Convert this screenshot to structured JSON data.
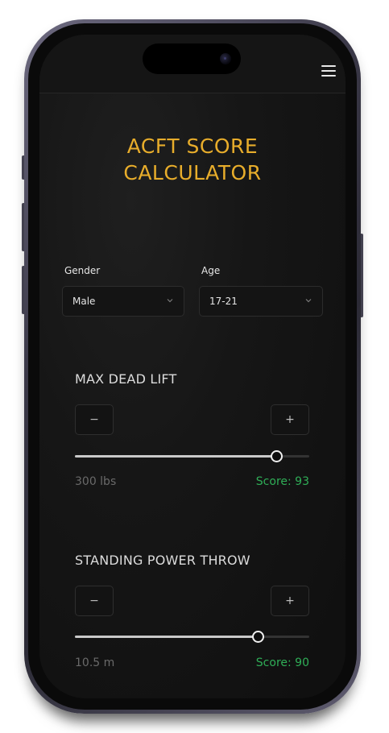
{
  "header": {
    "menu_icon": "hamburger-menu-icon"
  },
  "title": "ACFT SCORE\nCALCULATOR",
  "colors": {
    "accent": "#e8ad2b",
    "score": "#2fae57",
    "background": "#141414"
  },
  "form": {
    "gender": {
      "label": "Gender",
      "value": "Male",
      "icon": "chevron-down-icon"
    },
    "age": {
      "label": "Age",
      "value": "17-21",
      "icon": "chevron-down-icon"
    }
  },
  "events": [
    {
      "title": "MAX DEAD LIFT",
      "minus": "−",
      "plus": "+",
      "slider_fraction": 0.86,
      "value": "300 lbs",
      "score": "Score: 93"
    },
    {
      "title": "STANDING POWER THROW",
      "minus": "−",
      "plus": "+",
      "slider_fraction": 0.78,
      "value": "10.5 m",
      "score": "Score: 90"
    }
  ]
}
